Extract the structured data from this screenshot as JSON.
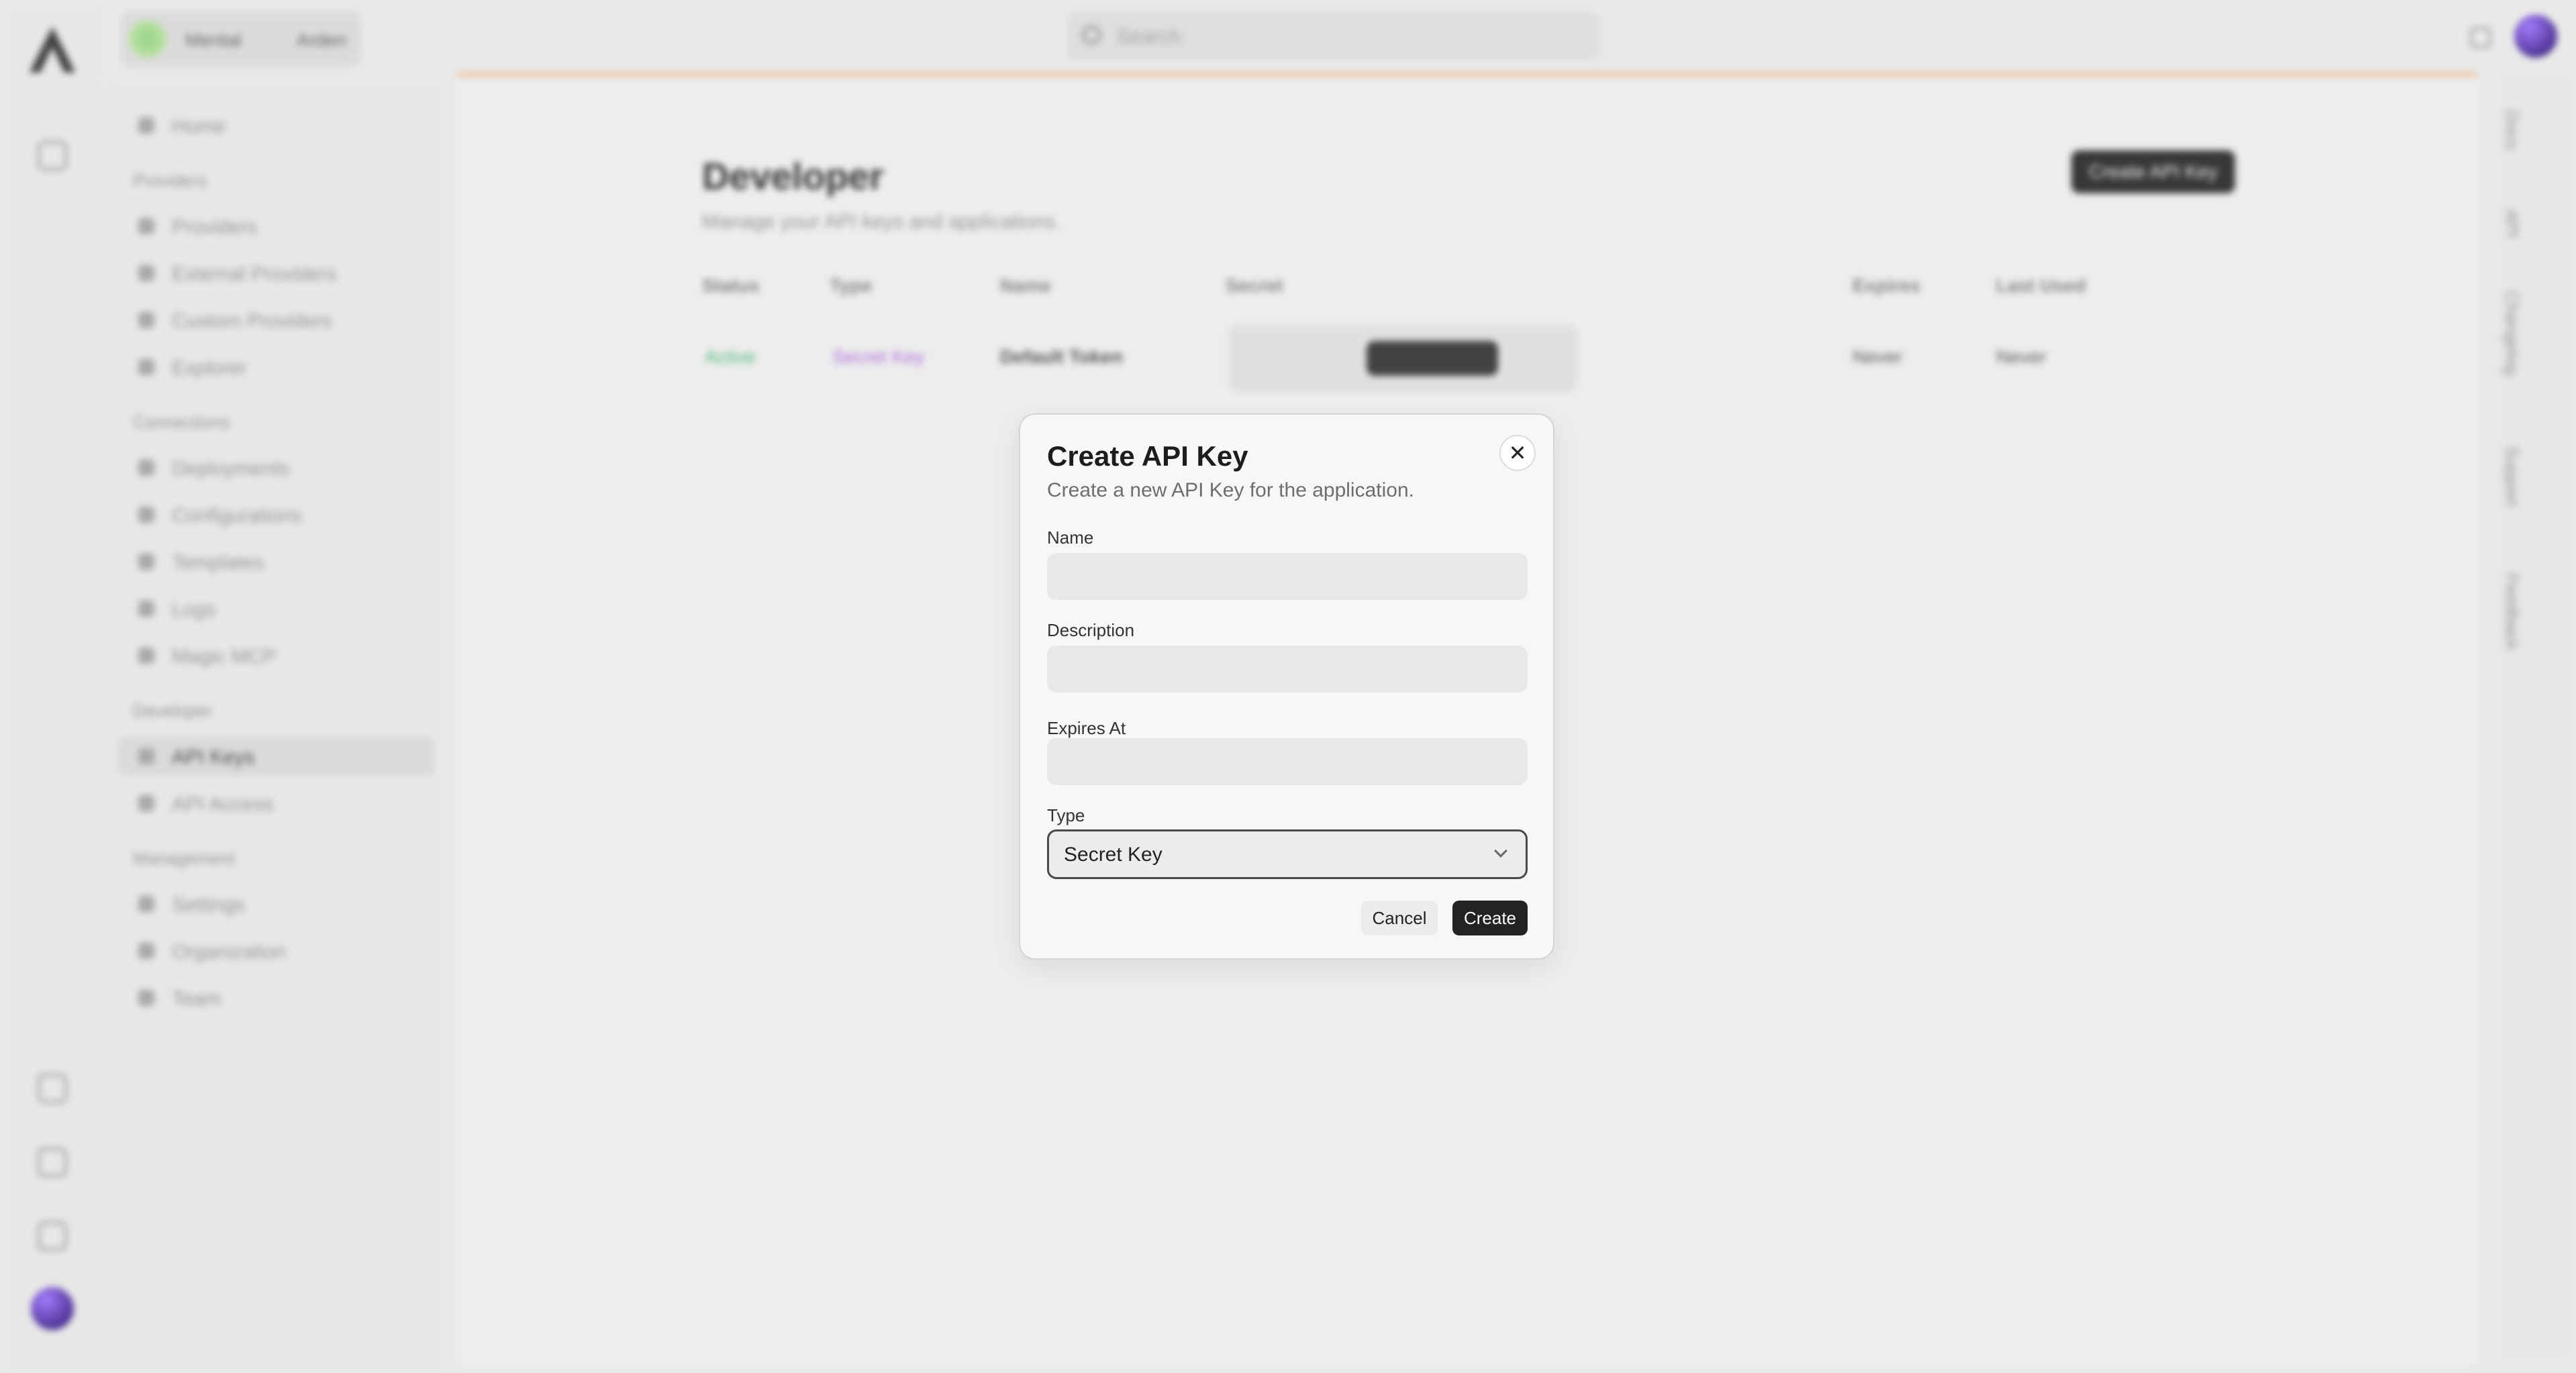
{
  "app": {
    "workspace": {
      "name": "Mental",
      "env": "Arden"
    },
    "search_placeholder": "Search",
    "sidebar": {
      "sections": [
        {
          "title": "Providers",
          "items": [
            "Home",
            "Providers",
            "External Providers",
            "Custom Providers",
            "Explorer"
          ]
        },
        {
          "title": "Connections",
          "items": [
            "Deployments",
            "Configurations",
            "Templates",
            "Logs",
            "Magic MCP"
          ]
        },
        {
          "title": "Developer",
          "items": [
            "API Keys",
            "API Access"
          ]
        },
        {
          "title": "Management",
          "items": [
            "Settings",
            "Organization",
            "Team"
          ]
        }
      ],
      "active_item": "API Keys"
    },
    "main": {
      "title": "Developer",
      "subtitle": "Manage your API keys and applications.",
      "create_button": "Create API Key",
      "table": {
        "columns": [
          "Status",
          "Type",
          "Name",
          "Secret",
          "Expires",
          "Last Used"
        ],
        "rows": [
          {
            "status": "Active",
            "type": "Secret Key",
            "name": "Default Token",
            "secret_action": "Show Secret",
            "expires": "Never",
            "last_used": "Never"
          }
        ]
      }
    },
    "right_rail": [
      "Docs",
      "API",
      "Changelog",
      "Support",
      "Feedback"
    ]
  },
  "dialog": {
    "title": "Create API Key",
    "description": "Create a new API Key for the application.",
    "fields": {
      "name": {
        "label": "Name",
        "value": "",
        "placeholder": ""
      },
      "description": {
        "label": "Description",
        "value": "",
        "placeholder": ""
      },
      "expires_at": {
        "label": "Expires At",
        "value": "",
        "placeholder": ""
      },
      "type": {
        "label": "Type",
        "selected": "Secret Key"
      }
    },
    "cancel_label": "Cancel",
    "create_label": "Create",
    "close_glyph": "✕"
  }
}
